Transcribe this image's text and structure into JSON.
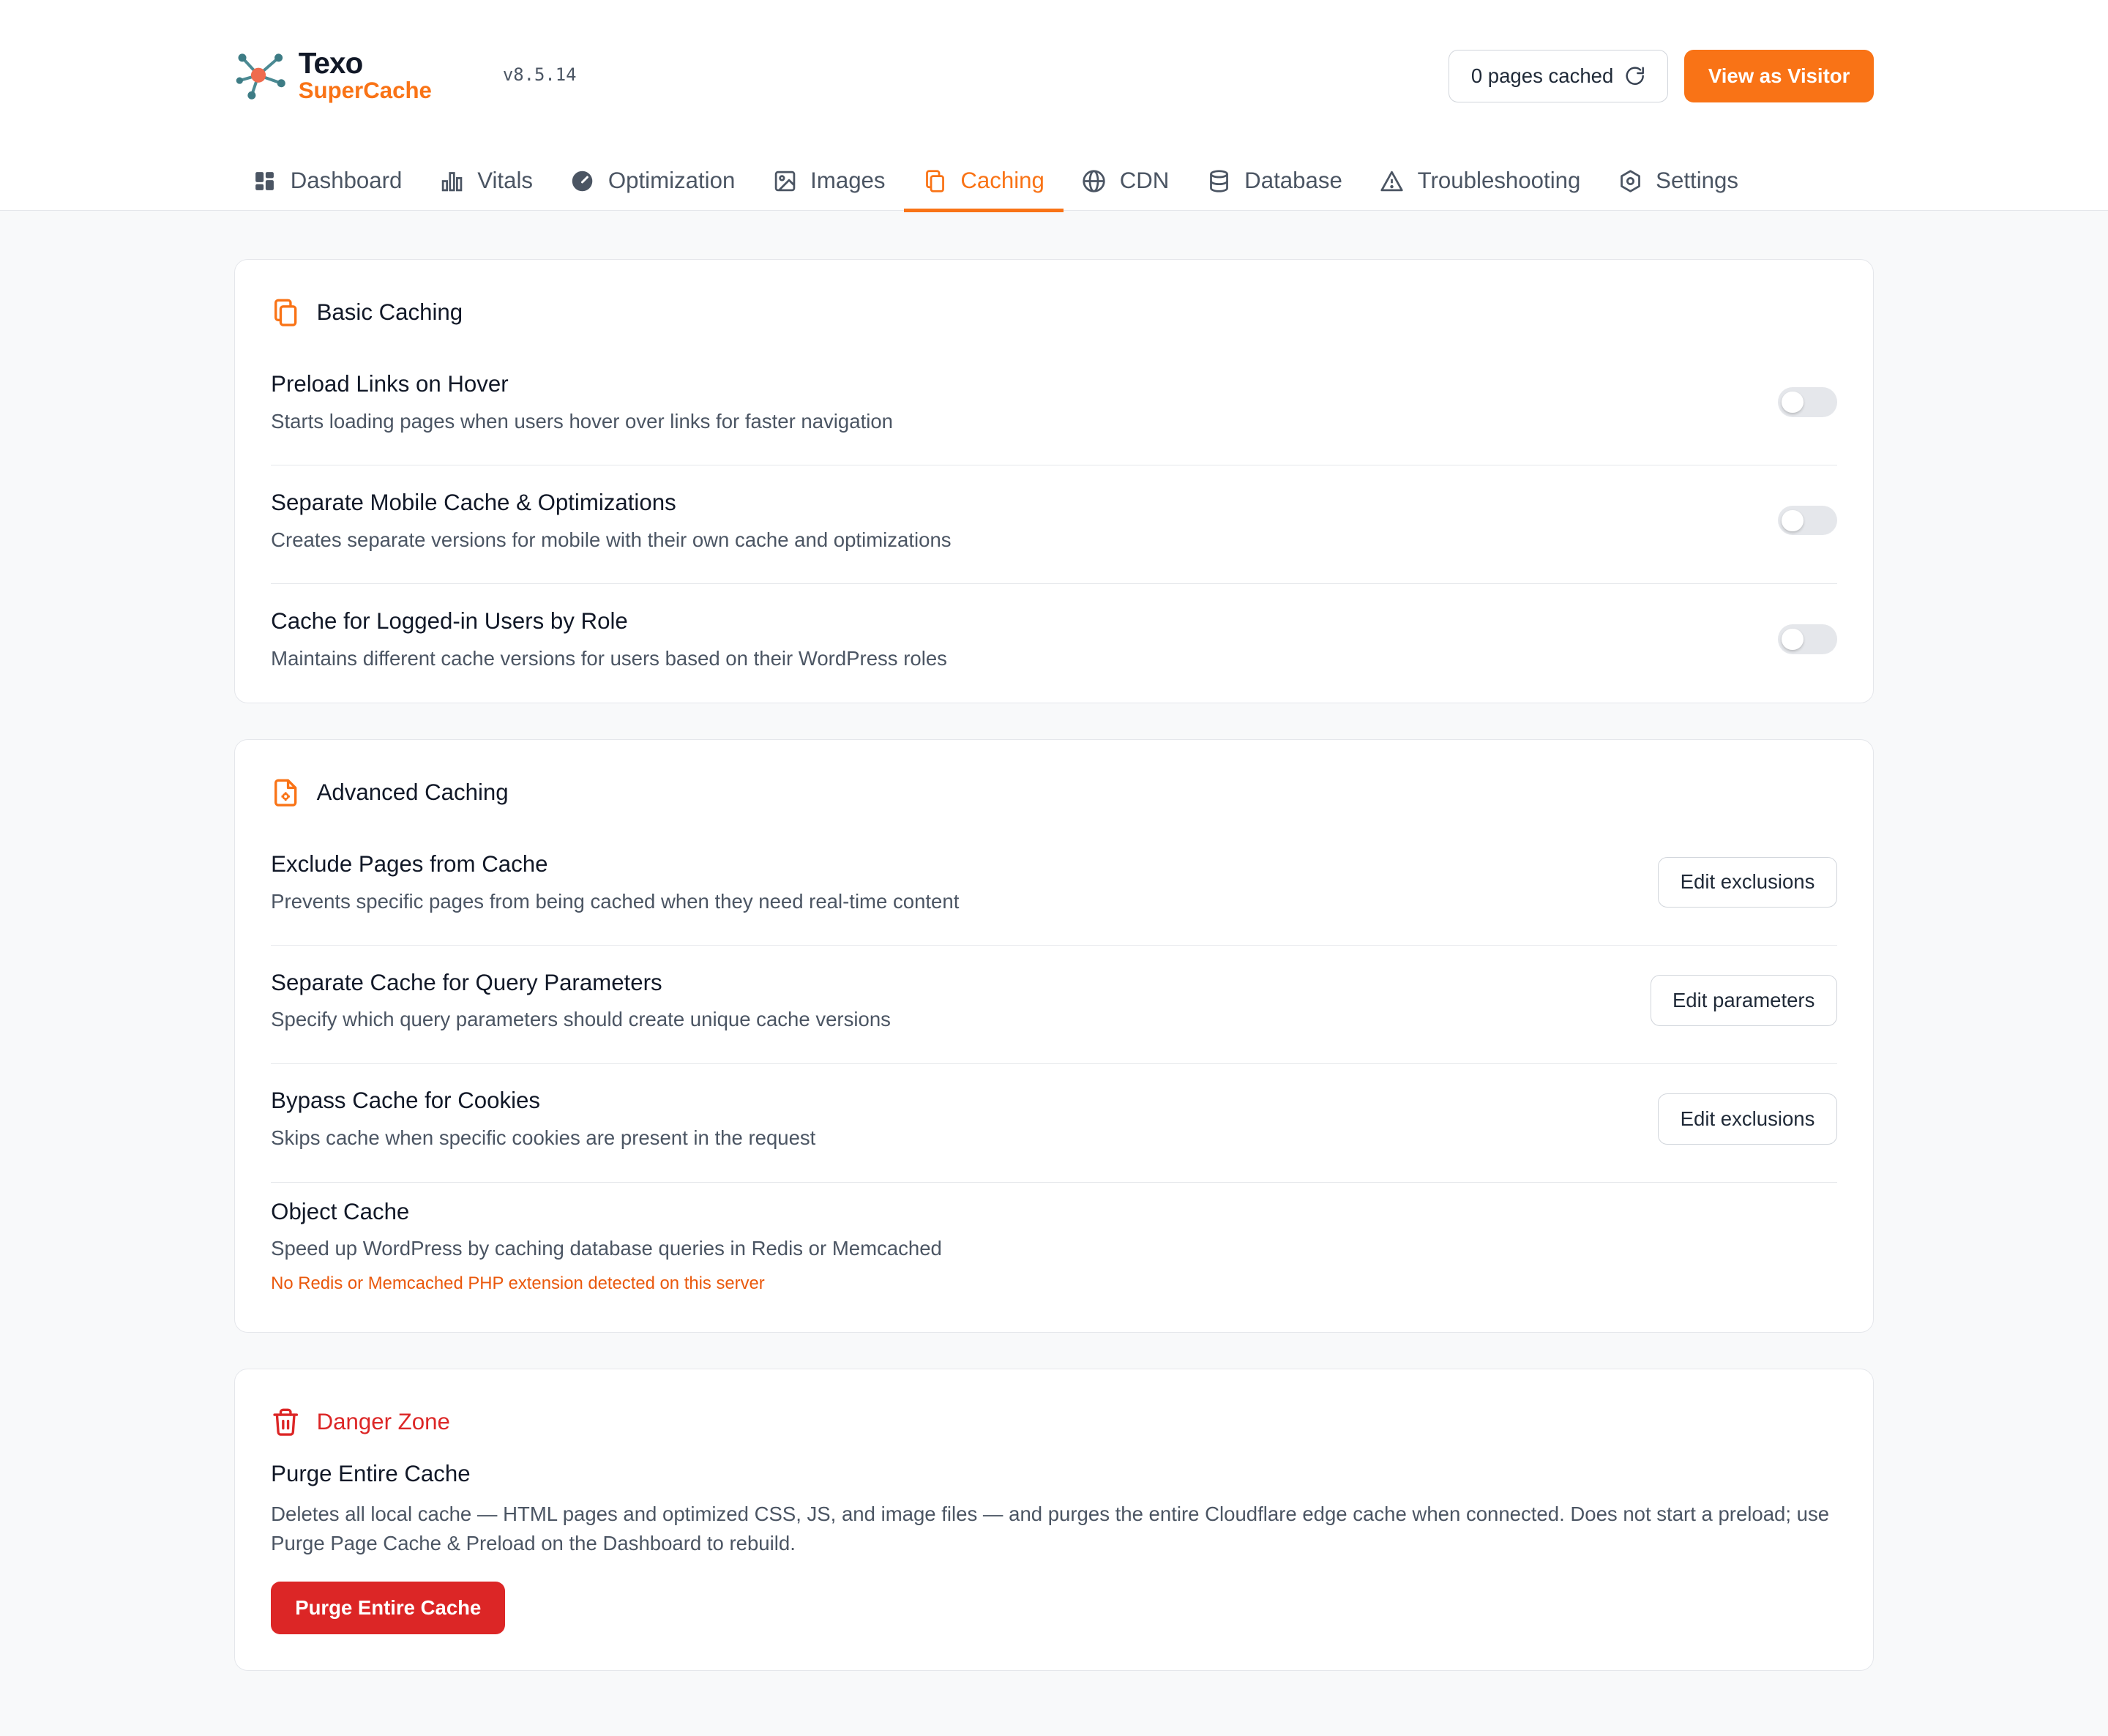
{
  "app": {
    "name_line1": "Texo",
    "name_line2": "SuperCache",
    "version": "v8.5.14"
  },
  "header": {
    "pages_cached": "0 pages cached",
    "view_as_visitor": "View as Visitor"
  },
  "tabs": [
    {
      "label": "Dashboard",
      "icon": "dashboard-icon"
    },
    {
      "label": "Vitals",
      "icon": "bar-chart-icon"
    },
    {
      "label": "Optimization",
      "icon": "gauge-icon"
    },
    {
      "label": "Images",
      "icon": "image-icon"
    },
    {
      "label": "Caching",
      "icon": "copy-icon",
      "active": true
    },
    {
      "label": "CDN",
      "icon": "globe-icon"
    },
    {
      "label": "Database",
      "icon": "database-icon"
    },
    {
      "label": "Troubleshooting",
      "icon": "warning-icon"
    },
    {
      "label": "Settings",
      "icon": "settings-icon"
    }
  ],
  "basic": {
    "title": "Basic Caching",
    "rows": [
      {
        "title": "Preload Links on Hover",
        "desc": "Starts loading pages when users hover over links for faster navigation",
        "enabled": false
      },
      {
        "title": "Separate Mobile Cache & Optimizations",
        "desc": "Creates separate versions for mobile with their own cache and optimizations",
        "enabled": false
      },
      {
        "title": "Cache for Logged-in Users by Role",
        "desc": "Maintains different cache versions for users based on their WordPress roles",
        "enabled": false
      }
    ]
  },
  "advanced": {
    "title": "Advanced Caching",
    "rows": [
      {
        "title": "Exclude Pages from Cache",
        "desc": "Prevents specific pages from being cached when they need real-time content",
        "button": "Edit exclusions"
      },
      {
        "title": "Separate Cache for Query Parameters",
        "desc": "Specify which query parameters should create unique cache versions",
        "button": "Edit parameters"
      },
      {
        "title": "Bypass Cache for Cookies",
        "desc": "Skips cache when specific cookies are present in the request",
        "button": "Edit exclusions"
      },
      {
        "title": "Object Cache",
        "desc": "Speed up WordPress by caching database queries in Redis or Memcached",
        "warning": "No Redis or Memcached PHP extension detected on this server"
      }
    ]
  },
  "danger": {
    "title": "Danger Zone",
    "item_title": "Purge Entire Cache",
    "item_desc": "Deletes all local cache — HTML pages and optimized CSS, JS, and image files — and purges the entire Cloudflare edge cache when connected. Does not start a preload; use Purge Page Cache & Preload on the Dashboard to rebuild.",
    "button": "Purge Entire Cache"
  },
  "colors": {
    "accent": "#f97316",
    "danger": "#dc2626",
    "warning_text": "#ea580c"
  }
}
